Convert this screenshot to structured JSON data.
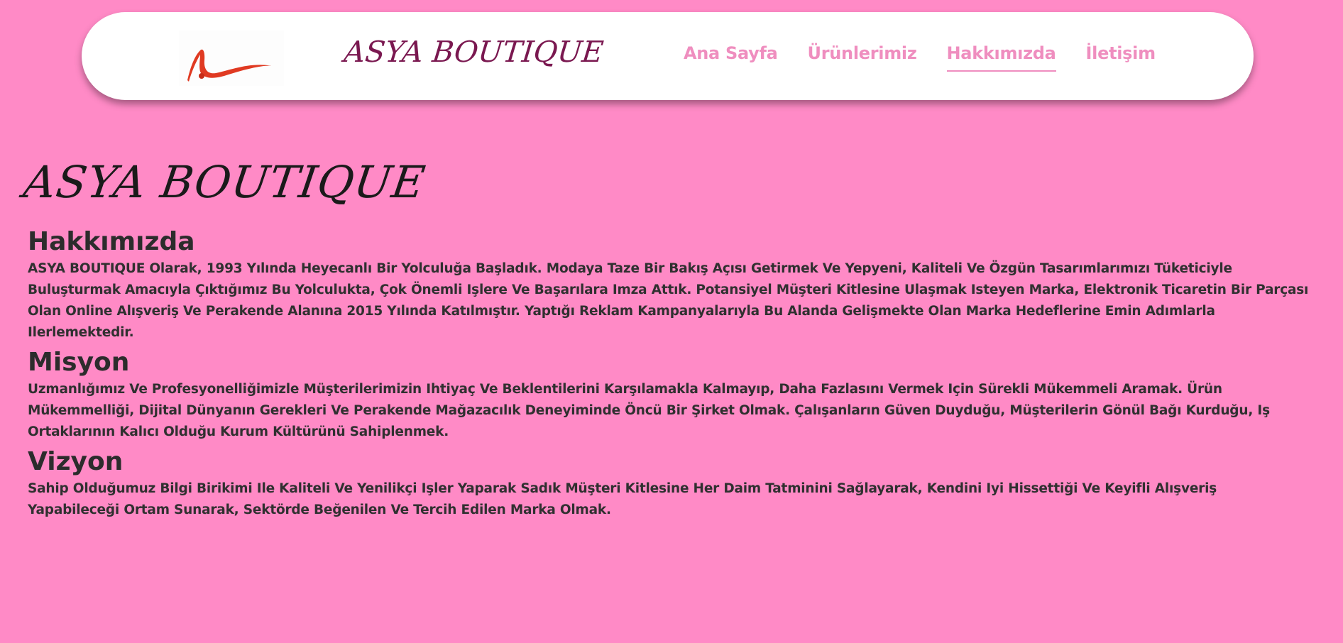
{
  "header": {
    "brand": "ASYA BOUTIQUE",
    "logo_icon": "brushstroke-a-logo",
    "nav": [
      {
        "label": "Ana Sayfa"
      },
      {
        "label": "Ürünlerimiz"
      },
      {
        "label": "Hakkımızda"
      },
      {
        "label": "İletişim"
      }
    ],
    "active_nav": "Hakkımızda"
  },
  "main": {
    "title": "ASYA BOUTIQUE",
    "sections": [
      {
        "heading": "Hakkımızda",
        "text": "ASYA BOUTIQUE Olarak, 1993 Yılında Heyecanlı Bir Yolculuğa Başladık. Modaya Taze Bir Bakış Açısı Getirmek Ve Yepyeni, Kaliteli Ve Özgün Tasarımlarımızı Tüketiciyle Buluşturmak Amacıyla Çıktığımız Bu Yolculukta, Çok Önemli Işlere Ve Başarılara Imza Attık. Potansiyel Müşteri Kitlesine Ulaşmak Isteyen Marka, Elektronik Ticaretin Bir Parçası Olan Online Alışveriş Ve Perakende Alanına 2015 Yılında Katılmıştır. Yaptığı Reklam Kampanyalarıyla Bu Alanda Gelişmekte Olan Marka Hedeflerine Emin Adımlarla Ilerlemektedir."
      },
      {
        "heading": "Misyon",
        "text": "Uzmanlığımız Ve Profesyonelliğimizle Müşterilerimizin Ihtiyaç Ve Beklentilerini Karşılamakla Kalmayıp, Daha Fazlasını Vermek Için Sürekli Mükemmeli Aramak. Ürün Mükemmelliği, Dijital Dünyanın Gerekleri Ve Perakende Mağazacılık Deneyiminde Öncü Bir Şirket Olmak. Çalışanların Güven Duyduğu, Müşterilerin Gönül Bağı Kurduğu, Iş Ortaklarının Kalıcı Olduğu Kurum Kültürünü Sahiplenmek."
      },
      {
        "heading": "Vizyon",
        "text": "Sahip Olduğumuz Bilgi Birikimi Ile Kaliteli Ve Yenilikçi Işler Yaparak Sadık Müşteri Kitlesine Her Daim Tatminini Sağlayarak, Kendini Iyi Hissettiği Ve Keyifli Alışveriş Yapabileceği Ortam Sunarak, Sektörde Beğenilen Ve Tercih Edilen Marka Olmak."
      }
    ]
  },
  "colors": {
    "page_background": "#ff8ac6",
    "nav_link": "#ef8ebf",
    "brand": "#7a1850",
    "logo_red": "#e03a22"
  }
}
